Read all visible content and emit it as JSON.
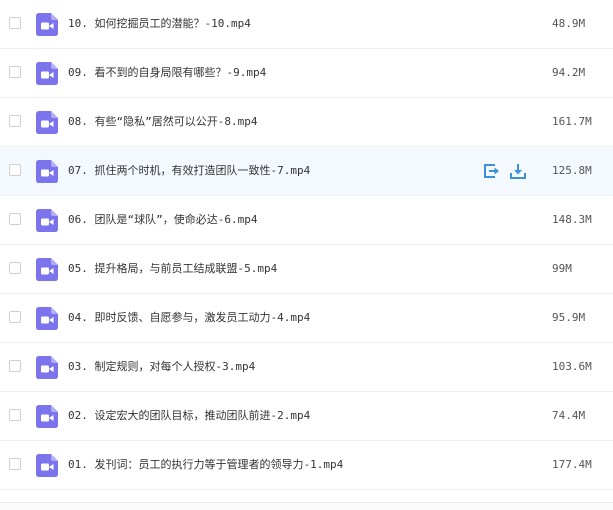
{
  "colors": {
    "video_icon": "#7b74ec",
    "action_icon": "#3d8fd8",
    "hover_row": "#f4f9ff"
  },
  "icons": {
    "file_type": "video-file-icon",
    "open": "open-share-icon",
    "download": "download-icon"
  },
  "files": [
    {
      "name": "10. 如何挖掘员工的潜能？-10.mp4",
      "size": "48.9M"
    },
    {
      "name": "09. 看不到的自身局限有哪些？-9.mp4",
      "size": "94.2M"
    },
    {
      "name": "08. 有些“隐私”居然可以公开-8.mp4",
      "size": "161.7M"
    },
    {
      "name": "07. 抓住两个时机，有效打造团队一致性-7.mp4",
      "size": "125.8M",
      "hovered": true
    },
    {
      "name": "06. 团队是“球队”，使命必达-6.mp4",
      "size": "148.3M"
    },
    {
      "name": "05. 提升格局，与前员工结成联盟-5.mp4",
      "size": "99M"
    },
    {
      "name": "04. 即时反馈、自愿参与，激发员工动力-4.mp4",
      "size": "95.9M"
    },
    {
      "name": "03. 制定规则，对每个人授权-3.mp4",
      "size": "103.6M"
    },
    {
      "name": "02. 设定宏大的团队目标，推动团队前进-2.mp4",
      "size": "74.4M"
    },
    {
      "name": "01. 发刊词：员工的执行力等于管理者的领导力-1.mp4",
      "size": "177.4M"
    }
  ]
}
